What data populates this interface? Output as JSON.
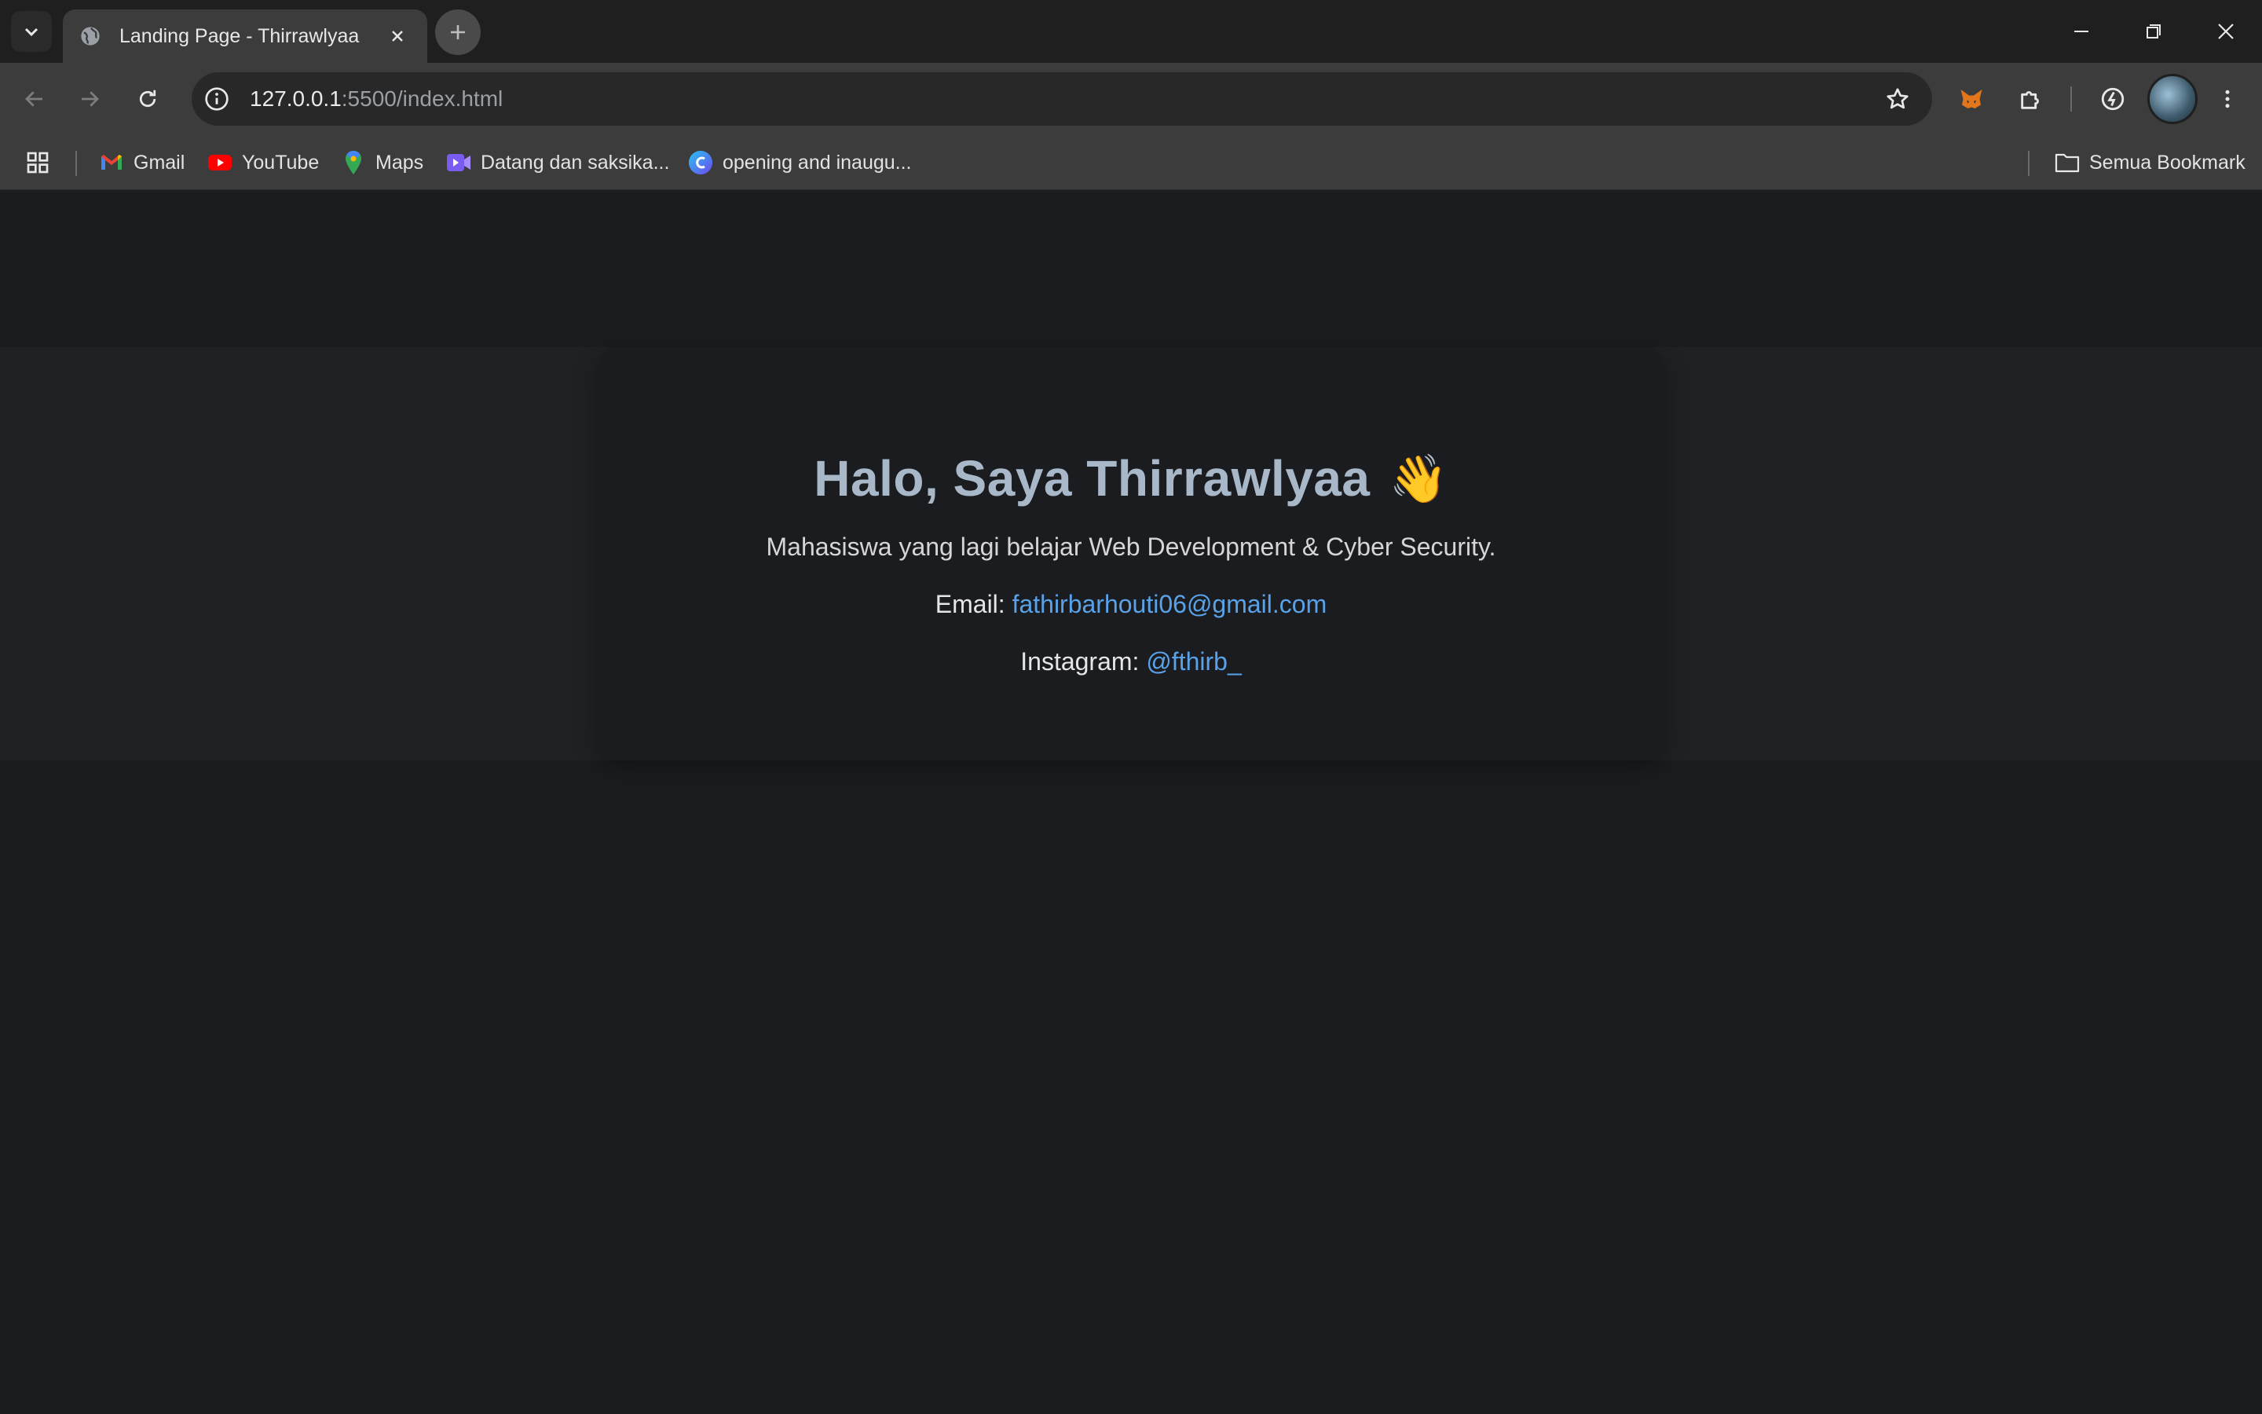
{
  "tab": {
    "title": "Landing Page - Thirrawlyaa"
  },
  "omnibox": {
    "host": "127.0.0.1",
    "path": ":5500/index.html"
  },
  "bookmarks": {
    "items": [
      {
        "label": "Gmail",
        "icon": "gmail-icon"
      },
      {
        "label": "YouTube",
        "icon": "youtube-icon"
      },
      {
        "label": "Maps",
        "icon": "maps-icon"
      },
      {
        "label": "Datang dan saksika...",
        "icon": "video-icon"
      },
      {
        "label": "opening and inaugu...",
        "icon": "canva-icon"
      }
    ],
    "all_bookmarks": "Semua Bookmark"
  },
  "page": {
    "heading": "Halo, Saya Thirrawlyaa",
    "heading_emoji": "👋",
    "subtitle": "Mahasiswa yang lagi belajar Web Development & Cyber Security.",
    "email_label": "Email:",
    "email_value": "fathirbarhouti06@gmail.com",
    "instagram_label": "Instagram:",
    "instagram_value": "@fthirb_"
  },
  "colors": {
    "heading": "#a9b8c9",
    "link": "#5aa2e8",
    "background": "#1b1c1f"
  }
}
